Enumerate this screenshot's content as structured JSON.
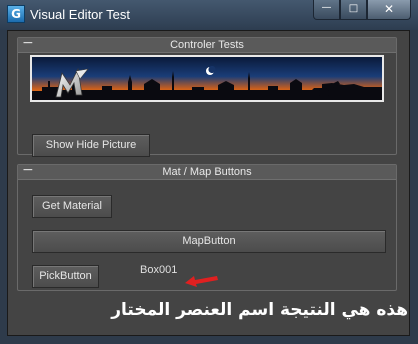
{
  "window": {
    "title": "Visual Editor Test",
    "app_icon_glyph": "G",
    "controls": {
      "minimize": "—",
      "maximize": "□",
      "close": "✕"
    }
  },
  "rollout_1": {
    "toggle": "−",
    "title": "Controler Tests",
    "banner_logo_text": "M",
    "show_hide_button": "Show Hide Picture"
  },
  "rollout_2": {
    "toggle": "−",
    "title": "Mat / Map Buttons",
    "get_material_button": "Get Material",
    "map_button": "MapButton",
    "pick_button": "PickButton",
    "pick_result": "Box001"
  },
  "annotation": {
    "text": "هذه هي النتيجة اسم العنصر المختار",
    "arrow_color": "#e02020"
  },
  "colors": {
    "panel_bg": "#444444",
    "title_bar": "#2d3d50",
    "banner_sky_top": "#0a1a3a",
    "banner_horizon": "#ff8a10"
  }
}
